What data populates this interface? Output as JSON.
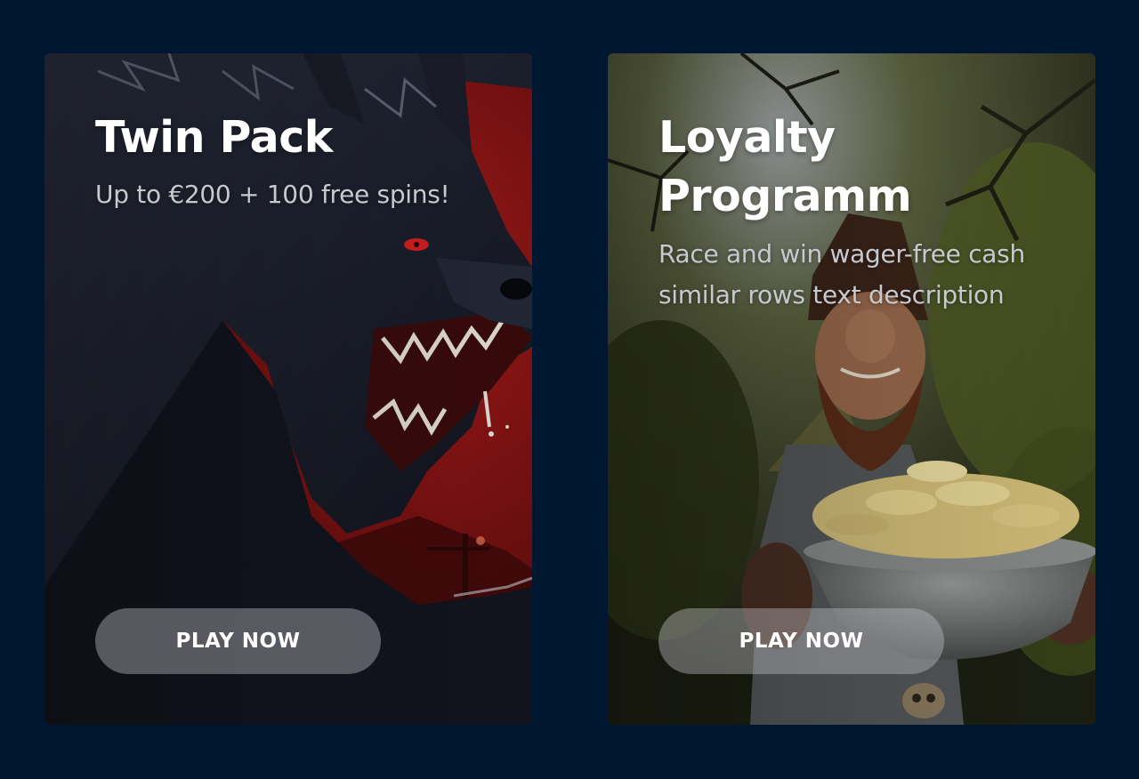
{
  "promotions": [
    {
      "title": "Twin Pack",
      "subtitle": "Up to €200 + 100 free spins!",
      "button_label": "PLAY NOW",
      "art": "werewolf-illustration"
    },
    {
      "title": "Loyalty Programm",
      "subtitle": "Race and win wager-free cash similar rows text description",
      "button_label": "PLAY NOW",
      "art": "gnome-with-gold-coins-illustration"
    }
  ],
  "colors": {
    "page_background": "#001731",
    "title_text": "#ffffff",
    "subtitle_text": "#c7c9cf",
    "wolf_card_red": "#8f1414",
    "gnome_card_green": "#4a5030"
  }
}
